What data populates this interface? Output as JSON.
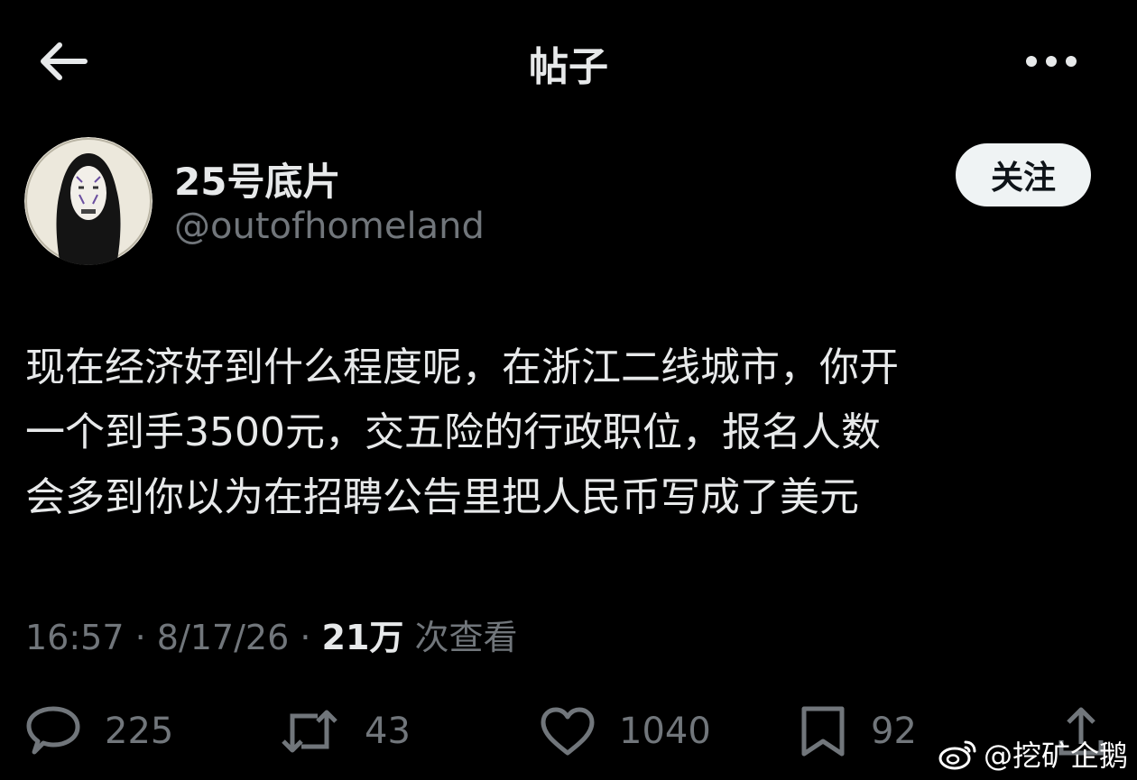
{
  "header": {
    "title": "帖子",
    "back_icon": "arrow-left-icon",
    "more_icon": "more-horizontal-icon"
  },
  "author": {
    "display_name": "25号底片",
    "handle": "@outofhomeland",
    "follow_label": "关注",
    "avatar_icon": "no-face-avatar"
  },
  "post": {
    "lines": [
      "现在经济好到什么程度呢，在浙江二线城市，你开",
      "一个到手3500元，交五险的行政职位，报名人数",
      "会多到你以为在招聘公告里把人民币写成了美元"
    ]
  },
  "meta": {
    "time": "16:57",
    "sep1": " · ",
    "date": "8/17/26",
    "sep2": " · ",
    "views_count": "21万",
    "views_label": " 次查看"
  },
  "actions": {
    "replies": "225",
    "retweets": "43",
    "likes": "1040",
    "bookmarks": "92"
  },
  "watermark": {
    "text": "@挖矿企鹅",
    "logo_icon": "weibo-logo"
  },
  "colors": {
    "background": "#000000",
    "text": "#e7e9ea",
    "secondary": "#71767b",
    "follow_bg": "#eff3f4"
  }
}
